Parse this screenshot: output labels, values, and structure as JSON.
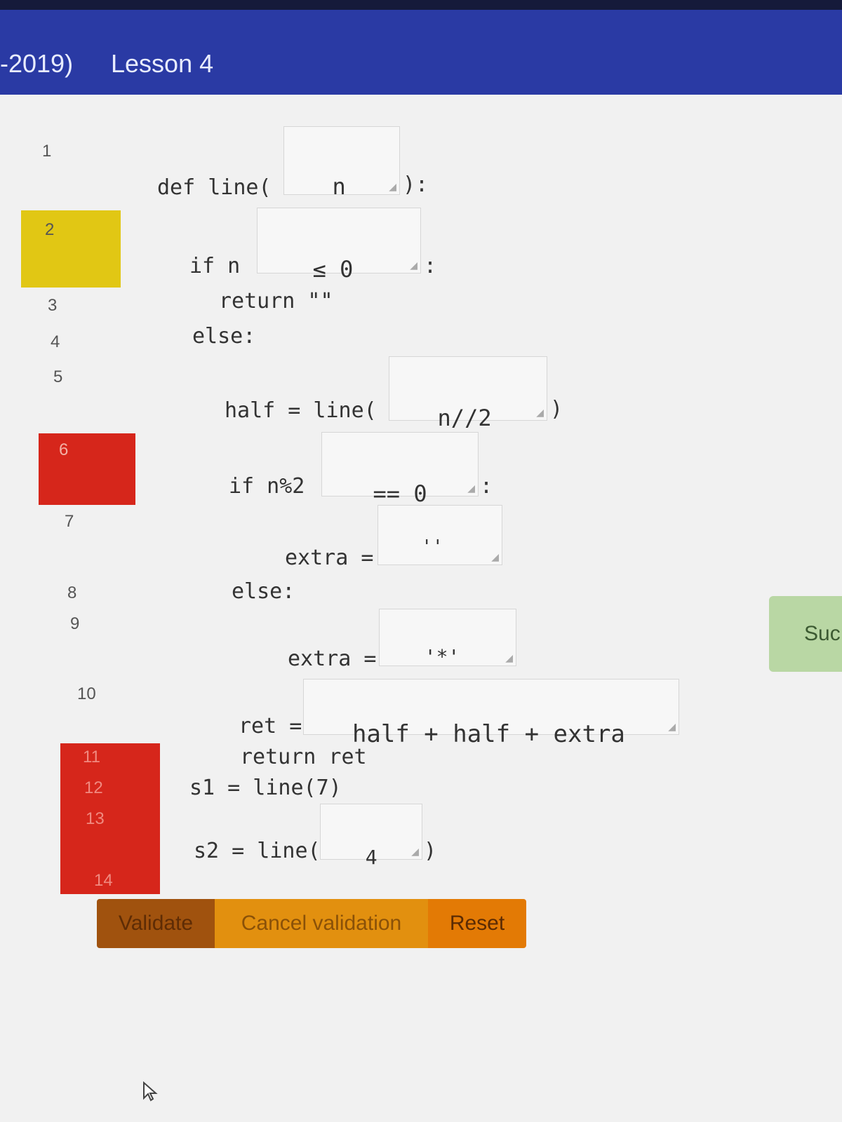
{
  "breadcrumb": {
    "course": "-2019)",
    "lesson": "Lesson 4"
  },
  "line_numbers": [
    "1",
    "2",
    "3",
    "4",
    "5",
    "6",
    "7",
    "8",
    "9",
    "10",
    "11",
    "12",
    "13",
    "14"
  ],
  "highlight_colors": {
    "warning": "#e1c714",
    "error": "#d6261b"
  },
  "code": {
    "l1_prefix": "def line(",
    "l1_input": "n",
    "l1_suffix": "):",
    "l2_prefix": "if n",
    "l2_input": "≤ 0",
    "l2_suffix": ":",
    "l3": "return \"\"",
    "l4": "else:",
    "l5_prefix": "half = line(",
    "l5_input": "n//2",
    "l5_suffix": ")",
    "l6_prefix": "if n%2",
    "l6_input": "== 0",
    "l6_suffix": ":",
    "l7_prefix": "extra =",
    "l7_input": "''",
    "l8": "else:",
    "l9_prefix": "extra =",
    "l9_input": "'*'",
    "l10_prefix": "ret =",
    "l10_input": "half + half + extra",
    "l11": "return ret",
    "l12": "s1 = line(7)",
    "l13_prefix": "s2 = line(",
    "l13_input": "4",
    "l13_suffix": ")"
  },
  "buttons": {
    "validate": "Validate",
    "cancel": "Cancel validation",
    "reset": "Reset"
  },
  "status": {
    "success_label": "Suc"
  },
  "icons": {
    "cursor": "mouse-pointer-icon",
    "resize": "resize-grip-icon"
  }
}
